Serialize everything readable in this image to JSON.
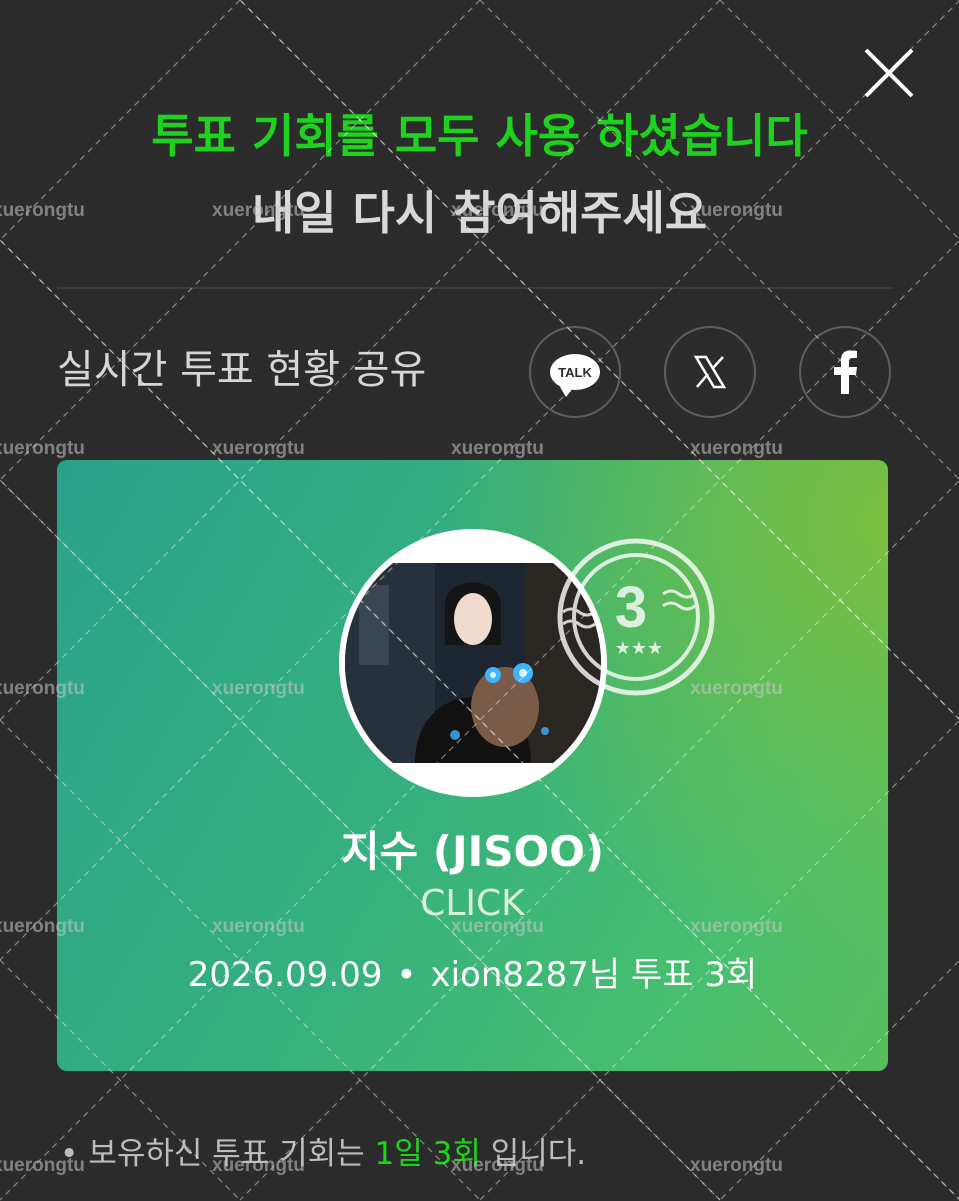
{
  "colors": {
    "background": "#2b2b2b",
    "accent_green": "#1ed31e",
    "card_gradient_start": "#2aa28a",
    "card_gradient_end": "#7bbf3f"
  },
  "modal": {
    "close_icon": "close-x-icon",
    "headline_primary": "투표 기회를 모두 사용 하셨습니다",
    "headline_secondary": "내일 다시 참여해주세요"
  },
  "share": {
    "label": "실시간 투표 현황 공유",
    "buttons": [
      {
        "icon": "kakaotalk-icon",
        "text": "TALK"
      },
      {
        "icon": "x-twitter-icon"
      },
      {
        "icon": "facebook-icon"
      }
    ]
  },
  "card": {
    "stamp_number": "3",
    "stamp_icon": "vote-count-stamp-icon",
    "artist_name": "지수 (JISOO)",
    "link_text": "CLICK",
    "date": "2026.09.09",
    "separator": "•",
    "vote_info": "xion8287님 투표 3회"
  },
  "notice": {
    "bullet": "•",
    "prefix": "보유하신 투표 기회는 ",
    "highlight": "1일 3회",
    "suffix": " 입니다."
  },
  "watermark_text": "xuerongtu"
}
